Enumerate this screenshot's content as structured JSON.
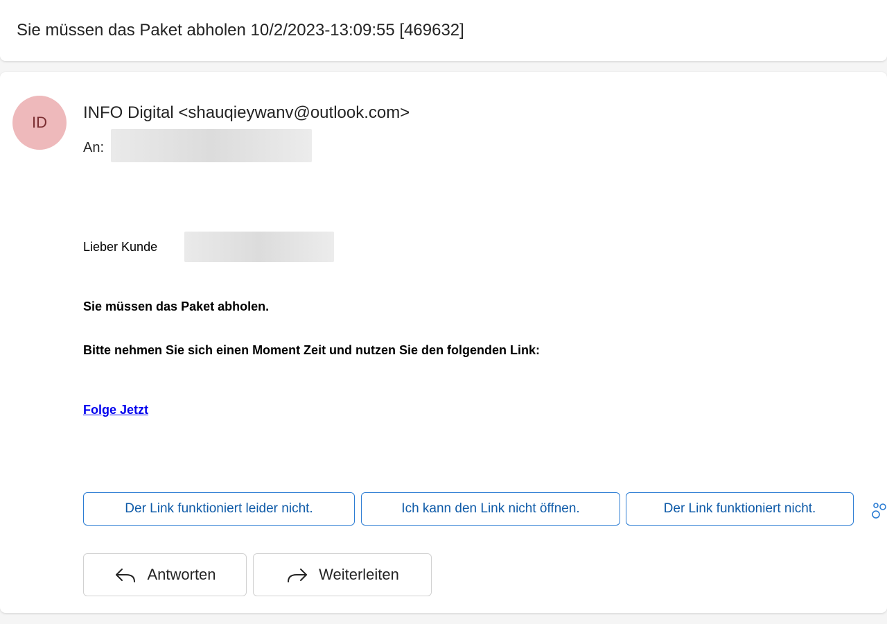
{
  "subject": "Sie müssen das Paket abholen 10/2/2023-13:09:55 [469632]",
  "sender": {
    "initials": "ID",
    "display": "INFO Digital <shauqieywanv@outlook.com>",
    "avatar_color": "#eeb9bb"
  },
  "recipient": {
    "label": "An:"
  },
  "body": {
    "greeting": "Lieber Kunde",
    "line1": "Sie müssen das Paket abholen.",
    "line2": "Bitte nehmen Sie sich einen Moment Zeit und nutzen Sie den folgenden Link:",
    "link_text": "Folge Jetzt"
  },
  "suggested_replies": [
    "Der Link funktioniert leider nicht.",
    "Ich kann den Link nicht öffnen.",
    "Der Link funktioniert nicht."
  ],
  "actions": {
    "reply": "Antworten",
    "forward": "Weiterleiten"
  },
  "icons": {
    "reply": "reply-arrow-icon",
    "forward": "forward-arrow-icon",
    "more": "sparkle-options-icon"
  },
  "colors": {
    "accent": "#2b7cd3",
    "link": "#0000ee"
  }
}
